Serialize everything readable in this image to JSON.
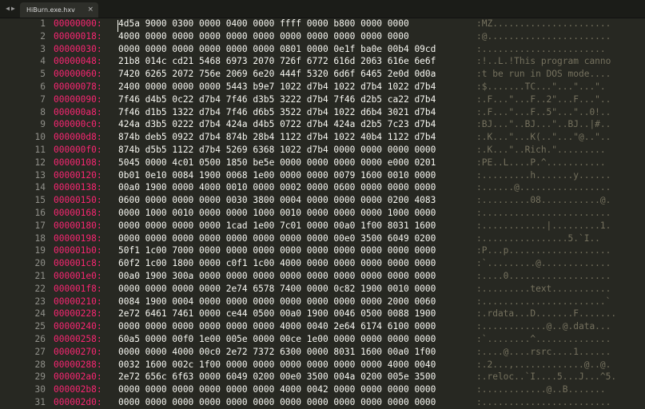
{
  "tab": {
    "title": "HiBurn.exe.hxv",
    "close": "×"
  },
  "nav": {
    "back": "◀",
    "forward": "▶"
  },
  "rows": [
    {
      "ln": "1",
      "addr": "00000000:",
      "hex": "4d5a 9000 0300 0000 0400 0000 ffff 0000 b800 0000 0000",
      "ascii": ":MZ......................"
    },
    {
      "ln": "2",
      "addr": "00000018:",
      "hex": "4000 0000 0000 0000 0000 0000 0000 0000 0000 0000 0000",
      "ascii": ":@......................."
    },
    {
      "ln": "3",
      "addr": "00000030:",
      "hex": "0000 0000 0000 0000 0000 0000 0801 0000 0e1f ba0e 00b4 09cd",
      "ascii": ":......................."
    },
    {
      "ln": "4",
      "addr": "00000048:",
      "hex": "21b8 014c cd21 5468 6973 2070 726f 6772 616d 2063 616e 6e6f",
      "ascii": ":!..L.!This program canno"
    },
    {
      "ln": "5",
      "addr": "00000060:",
      "hex": "7420 6265 2072 756e 2069 6e20 444f 5320 6d6f 6465 2e0d 0d0a",
      "ascii": ":t be run in DOS mode...."
    },
    {
      "ln": "6",
      "addr": "00000078:",
      "hex": "2400 0000 0000 0000 5443 b9e7 1022 d7b4 1022 d7b4 1022 d7b4",
      "ascii": ":$.......TC...\"...\"...\"."
    },
    {
      "ln": "7",
      "addr": "00000090:",
      "hex": "7f46 d4b5 0c22 d7b4 7f46 d3b5 3222 d7b4 7f46 d2b5 ca22 d7b4",
      "ascii": ":.F...\"...F..2\"...F...\".."
    },
    {
      "ln": "8",
      "addr": "000000a8:",
      "hex": "7f46 d1b5 1322 d7b4 7f46 d6b5 3522 d7b4 1022 d6b4 3021 d7b4",
      "ascii": ":.F...\"...F..5\"...\"..0!.."
    },
    {
      "ln": "9",
      "addr": "000000c0:",
      "hex": "424a d3b5 0222 d7b4 424a d4b5 0722 d7b4 424a d2b5 7c23 d7b4",
      "ascii": ":BJ...\"..BJ...\"..BJ..|#.."
    },
    {
      "ln": "10",
      "addr": "000000d8:",
      "hex": "874b deb5 0922 d7b4 874b 28b4 1122 d7b4 1022 40b4 1122 d7b4",
      "ascii": ":.K...\"...K(..\"...\"@..\".."
    },
    {
      "ln": "11",
      "addr": "000000f0:",
      "hex": "874b d5b5 1122 d7b4 5269 6368 1022 d7b4 0000 0000 0000 0000",
      "ascii": ":.K...\"..Rich.\"........."
    },
    {
      "ln": "12",
      "addr": "00000108:",
      "hex": "5045 0000 4c01 0500 1850 be5e 0000 0000 0000 0000 e000 0201",
      "ascii": ":PE..L....P.^..........."
    },
    {
      "ln": "13",
      "addr": "00000120:",
      "hex": "0b01 0e10 0084 1900 0068 1e00 0000 0000 0079 1600 0010 0000",
      "ascii": ":.........h.......y......"
    },
    {
      "ln": "14",
      "addr": "00000138:",
      "hex": "00a0 1900 0000 4000 0010 0000 0002 0000 0600 0000 0000 0000",
      "ascii": ":......@................."
    },
    {
      "ln": "15",
      "addr": "00000150:",
      "hex": "0600 0000 0000 0000 0030 3800 0004 0000 0000 0000 0200 4083",
      "ascii": ":.........08...........@."
    },
    {
      "ln": "16",
      "addr": "00000168:",
      "hex": "0000 1000 0010 0000 0000 1000 0010 0000 0000 0000 1000 0000",
      "ascii": ":........................"
    },
    {
      "ln": "17",
      "addr": "00000180:",
      "hex": "0000 0000 0000 0000 1cad 1e00 7c01 0000 00a0 1f00 8031 1600",
      "ascii": ":............|.........1."
    },
    {
      "ln": "18",
      "addr": "00000198:",
      "hex": "0000 0000 0000 0000 0000 0000 0000 0000 00e0 3500 6049 0200",
      "ascii": ":................5.`I.."
    },
    {
      "ln": "19",
      "addr": "000001b0:",
      "hex": "50f1 1c00 7000 0000 0000 0000 0000 0000 0000 0000 0000 0000",
      "ascii": ":P...p..................."
    },
    {
      "ln": "20",
      "addr": "000001c8:",
      "hex": "60f2 1c00 1800 0000 c0f1 1c00 4000 0000 0000 0000 0000 0000",
      "ascii": ":`.........@............."
    },
    {
      "ln": "21",
      "addr": "000001e0:",
      "hex": "00a0 1900 300a 0000 0000 0000 0000 0000 0000 0000 0000 0000",
      "ascii": ":....0..................."
    },
    {
      "ln": "22",
      "addr": "000001f8:",
      "hex": "0000 0000 0000 0000 2e74 6578 7400 0000 0c82 1900 0010 0000",
      "ascii": ":.........text..........."
    },
    {
      "ln": "23",
      "addr": "00000210:",
      "hex": "0084 1900 0004 0000 0000 0000 0000 0000 0000 0000 2000 0060",
      "ascii": ":.......................`"
    },
    {
      "ln": "24",
      "addr": "00000228:",
      "hex": "2e72 6461 7461 0000 ce44 0500 00a0 1900 0046 0500 0088 1900",
      "ascii": ":.rdata...D.......F......."
    },
    {
      "ln": "25",
      "addr": "00000240:",
      "hex": "0000 0000 0000 0000 0000 0000 4000 0040 2e64 6174 6100 0000",
      "ascii": ":............@..@.data..."
    },
    {
      "ln": "26",
      "addr": "00000258:",
      "hex": "60a5 0000 00f0 1e00 005e 0000 00ce 1e00 0000 0000 0000 0000",
      "ascii": ":`........^.............."
    },
    {
      "ln": "27",
      "addr": "00000270:",
      "hex": "0000 0000 4000 00c0 2e72 7372 6300 0000 8031 1600 00a0 1f00",
      "ascii": ":....@....rsrc....1......"
    },
    {
      "ln": "28",
      "addr": "00000288:",
      "hex": "0032 1600 002c 1f00 0000 0000 0000 0000 0000 0000 4000 0040",
      "ascii": ":.2...,.............@..@."
    },
    {
      "ln": "29",
      "addr": "000002a0:",
      "hex": "2e72 656c 6f63 0000 6049 0200 00e0 3500 004a 0200 005e 3500",
      "ascii": ":.reloc..`I....5...J...^5."
    },
    {
      "ln": "30",
      "addr": "000002b8:",
      "hex": "0000 0000 0000 0000 0000 0000 4000 0042 0000 0000 0000 0000",
      "ascii": ":............@..B......."
    },
    {
      "ln": "31",
      "addr": "000002d0:",
      "hex": "0000 0000 0000 0000 0000 0000 0000 0000 0000 0000 0000 0000",
      "ascii": ":........................"
    }
  ]
}
